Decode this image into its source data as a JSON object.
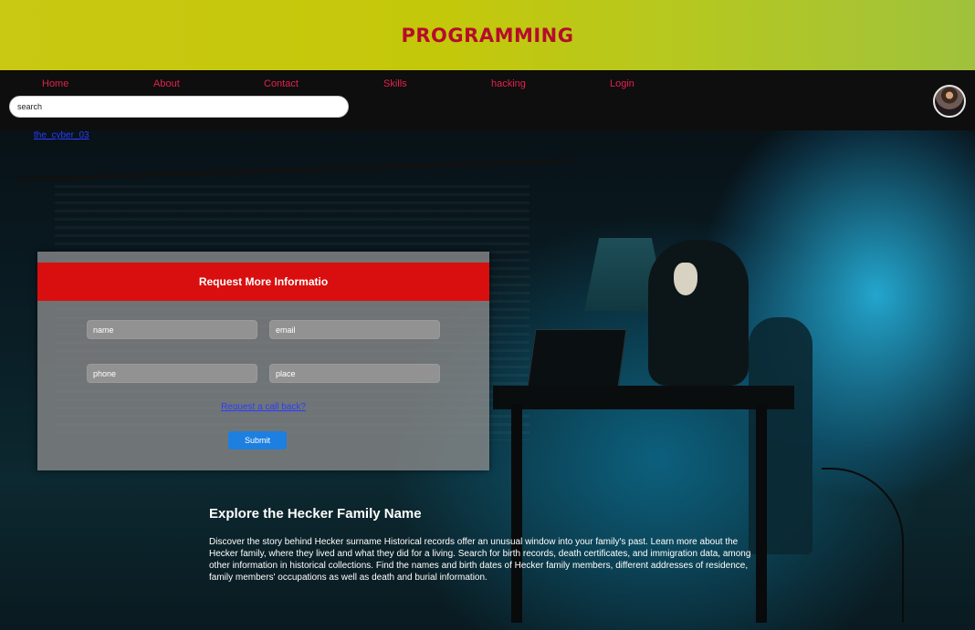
{
  "banner": {
    "title": "PROGRAMMING"
  },
  "nav": {
    "items": [
      {
        "label": "Home"
      },
      {
        "label": "About"
      },
      {
        "label": "Contact"
      },
      {
        "label": "Skills"
      },
      {
        "label": "hacking"
      },
      {
        "label": "Login"
      }
    ],
    "search_placeholder": "search"
  },
  "profile": {
    "link_text": "the_cyber_03"
  },
  "form": {
    "title": "Request More Informatio",
    "name_placeholder": "name",
    "email_placeholder": "email",
    "phone_placeholder": "phone",
    "place_placeholder": "place",
    "callback_link": "Request a call back?",
    "submit_label": "Submit"
  },
  "article": {
    "title": "Explore the Hecker Family Name",
    "body": "Discover the story behind Hecker surname Historical records offer an unusual window into your family's past. Learn more about the Hecker family, where they lived and what they did for a living. Search for birth records, death certificates, and immigration data, among other information in historical collections. Find the names and birth dates of Hecker family members, different addresses of residence, family members' occupations as well as death and burial information."
  },
  "colors": {
    "banner": "#c9c812",
    "nav_link": "#e0224f",
    "form_header": "#d90f0f",
    "submit": "#1d7fe0",
    "title": "#b50d2b"
  }
}
